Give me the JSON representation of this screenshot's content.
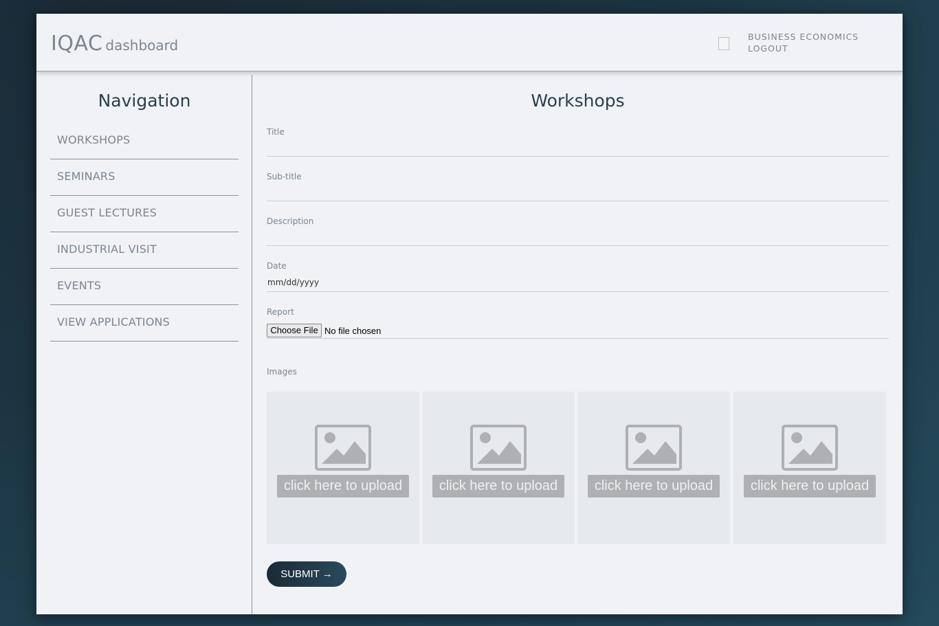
{
  "header": {
    "brand_main": "IQAC",
    "brand_sub": "dashboard",
    "user_name": "BUSINESS ECONOMICS",
    "logout_label": "LOGOUT"
  },
  "sidebar": {
    "title": "Navigation",
    "items": [
      {
        "label": "WORKSHOPS"
      },
      {
        "label": "SEMINARS"
      },
      {
        "label": "GUEST LECTURES"
      },
      {
        "label": "INDUSTRIAL VISIT"
      },
      {
        "label": "EVENTS"
      },
      {
        "label": "VIEW APPLICATIONS"
      }
    ]
  },
  "form": {
    "title": "Workshops",
    "fields": {
      "title_label": "Title",
      "subtitle_label": "Sub-title",
      "description_label": "Description",
      "date_label": "Date",
      "date_value": "mm/dd/yyyy",
      "report_label": "Report",
      "file_button": "Choose File",
      "file_status": "No file chosen"
    },
    "images_label": "Images",
    "upload_tiles": [
      {
        "label": "click here to upload"
      },
      {
        "label": "click here to upload"
      },
      {
        "label": "click here to upload"
      },
      {
        "label": "click here to upload"
      }
    ],
    "submit_label": "SUBMIT →"
  },
  "colors": {
    "card_bg": "#f0f2f5",
    "accent_dark": "#1a2a36",
    "muted_text": "#7c8590",
    "placeholder_gray": "#aeb0b3"
  }
}
